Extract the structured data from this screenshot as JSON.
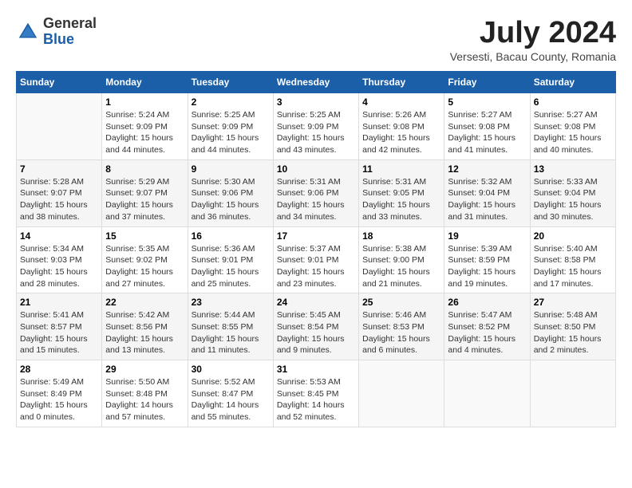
{
  "header": {
    "logo_general": "General",
    "logo_blue": "Blue",
    "title": "July 2024",
    "subtitle": "Versesti, Bacau County, Romania"
  },
  "calendar": {
    "days_of_week": [
      "Sunday",
      "Monday",
      "Tuesday",
      "Wednesday",
      "Thursday",
      "Friday",
      "Saturday"
    ],
    "weeks": [
      [
        {
          "day": "",
          "sunrise": "",
          "sunset": "",
          "daylight": ""
        },
        {
          "day": "1",
          "sunrise": "Sunrise: 5:24 AM",
          "sunset": "Sunset: 9:09 PM",
          "daylight": "Daylight: 15 hours and 44 minutes."
        },
        {
          "day": "2",
          "sunrise": "Sunrise: 5:25 AM",
          "sunset": "Sunset: 9:09 PM",
          "daylight": "Daylight: 15 hours and 44 minutes."
        },
        {
          "day": "3",
          "sunrise": "Sunrise: 5:25 AM",
          "sunset": "Sunset: 9:09 PM",
          "daylight": "Daylight: 15 hours and 43 minutes."
        },
        {
          "day": "4",
          "sunrise": "Sunrise: 5:26 AM",
          "sunset": "Sunset: 9:08 PM",
          "daylight": "Daylight: 15 hours and 42 minutes."
        },
        {
          "day": "5",
          "sunrise": "Sunrise: 5:27 AM",
          "sunset": "Sunset: 9:08 PM",
          "daylight": "Daylight: 15 hours and 41 minutes."
        },
        {
          "day": "6",
          "sunrise": "Sunrise: 5:27 AM",
          "sunset": "Sunset: 9:08 PM",
          "daylight": "Daylight: 15 hours and 40 minutes."
        }
      ],
      [
        {
          "day": "7",
          "sunrise": "Sunrise: 5:28 AM",
          "sunset": "Sunset: 9:07 PM",
          "daylight": "Daylight: 15 hours and 38 minutes."
        },
        {
          "day": "8",
          "sunrise": "Sunrise: 5:29 AM",
          "sunset": "Sunset: 9:07 PM",
          "daylight": "Daylight: 15 hours and 37 minutes."
        },
        {
          "day": "9",
          "sunrise": "Sunrise: 5:30 AM",
          "sunset": "Sunset: 9:06 PM",
          "daylight": "Daylight: 15 hours and 36 minutes."
        },
        {
          "day": "10",
          "sunrise": "Sunrise: 5:31 AM",
          "sunset": "Sunset: 9:06 PM",
          "daylight": "Daylight: 15 hours and 34 minutes."
        },
        {
          "day": "11",
          "sunrise": "Sunrise: 5:31 AM",
          "sunset": "Sunset: 9:05 PM",
          "daylight": "Daylight: 15 hours and 33 minutes."
        },
        {
          "day": "12",
          "sunrise": "Sunrise: 5:32 AM",
          "sunset": "Sunset: 9:04 PM",
          "daylight": "Daylight: 15 hours and 31 minutes."
        },
        {
          "day": "13",
          "sunrise": "Sunrise: 5:33 AM",
          "sunset": "Sunset: 9:04 PM",
          "daylight": "Daylight: 15 hours and 30 minutes."
        }
      ],
      [
        {
          "day": "14",
          "sunrise": "Sunrise: 5:34 AM",
          "sunset": "Sunset: 9:03 PM",
          "daylight": "Daylight: 15 hours and 28 minutes."
        },
        {
          "day": "15",
          "sunrise": "Sunrise: 5:35 AM",
          "sunset": "Sunset: 9:02 PM",
          "daylight": "Daylight: 15 hours and 27 minutes."
        },
        {
          "day": "16",
          "sunrise": "Sunrise: 5:36 AM",
          "sunset": "Sunset: 9:01 PM",
          "daylight": "Daylight: 15 hours and 25 minutes."
        },
        {
          "day": "17",
          "sunrise": "Sunrise: 5:37 AM",
          "sunset": "Sunset: 9:01 PM",
          "daylight": "Daylight: 15 hours and 23 minutes."
        },
        {
          "day": "18",
          "sunrise": "Sunrise: 5:38 AM",
          "sunset": "Sunset: 9:00 PM",
          "daylight": "Daylight: 15 hours and 21 minutes."
        },
        {
          "day": "19",
          "sunrise": "Sunrise: 5:39 AM",
          "sunset": "Sunset: 8:59 PM",
          "daylight": "Daylight: 15 hours and 19 minutes."
        },
        {
          "day": "20",
          "sunrise": "Sunrise: 5:40 AM",
          "sunset": "Sunset: 8:58 PM",
          "daylight": "Daylight: 15 hours and 17 minutes."
        }
      ],
      [
        {
          "day": "21",
          "sunrise": "Sunrise: 5:41 AM",
          "sunset": "Sunset: 8:57 PM",
          "daylight": "Daylight: 15 hours and 15 minutes."
        },
        {
          "day": "22",
          "sunrise": "Sunrise: 5:42 AM",
          "sunset": "Sunset: 8:56 PM",
          "daylight": "Daylight: 15 hours and 13 minutes."
        },
        {
          "day": "23",
          "sunrise": "Sunrise: 5:44 AM",
          "sunset": "Sunset: 8:55 PM",
          "daylight": "Daylight: 15 hours and 11 minutes."
        },
        {
          "day": "24",
          "sunrise": "Sunrise: 5:45 AM",
          "sunset": "Sunset: 8:54 PM",
          "daylight": "Daylight: 15 hours and 9 minutes."
        },
        {
          "day": "25",
          "sunrise": "Sunrise: 5:46 AM",
          "sunset": "Sunset: 8:53 PM",
          "daylight": "Daylight: 15 hours and 6 minutes."
        },
        {
          "day": "26",
          "sunrise": "Sunrise: 5:47 AM",
          "sunset": "Sunset: 8:52 PM",
          "daylight": "Daylight: 15 hours and 4 minutes."
        },
        {
          "day": "27",
          "sunrise": "Sunrise: 5:48 AM",
          "sunset": "Sunset: 8:50 PM",
          "daylight": "Daylight: 15 hours and 2 minutes."
        }
      ],
      [
        {
          "day": "28",
          "sunrise": "Sunrise: 5:49 AM",
          "sunset": "Sunset: 8:49 PM",
          "daylight": "Daylight: 15 hours and 0 minutes."
        },
        {
          "day": "29",
          "sunrise": "Sunrise: 5:50 AM",
          "sunset": "Sunset: 8:48 PM",
          "daylight": "Daylight: 14 hours and 57 minutes."
        },
        {
          "day": "30",
          "sunrise": "Sunrise: 5:52 AM",
          "sunset": "Sunset: 8:47 PM",
          "daylight": "Daylight: 14 hours and 55 minutes."
        },
        {
          "day": "31",
          "sunrise": "Sunrise: 5:53 AM",
          "sunset": "Sunset: 8:45 PM",
          "daylight": "Daylight: 14 hours and 52 minutes."
        },
        {
          "day": "",
          "sunrise": "",
          "sunset": "",
          "daylight": ""
        },
        {
          "day": "",
          "sunrise": "",
          "sunset": "",
          "daylight": ""
        },
        {
          "day": "",
          "sunrise": "",
          "sunset": "",
          "daylight": ""
        }
      ]
    ]
  }
}
